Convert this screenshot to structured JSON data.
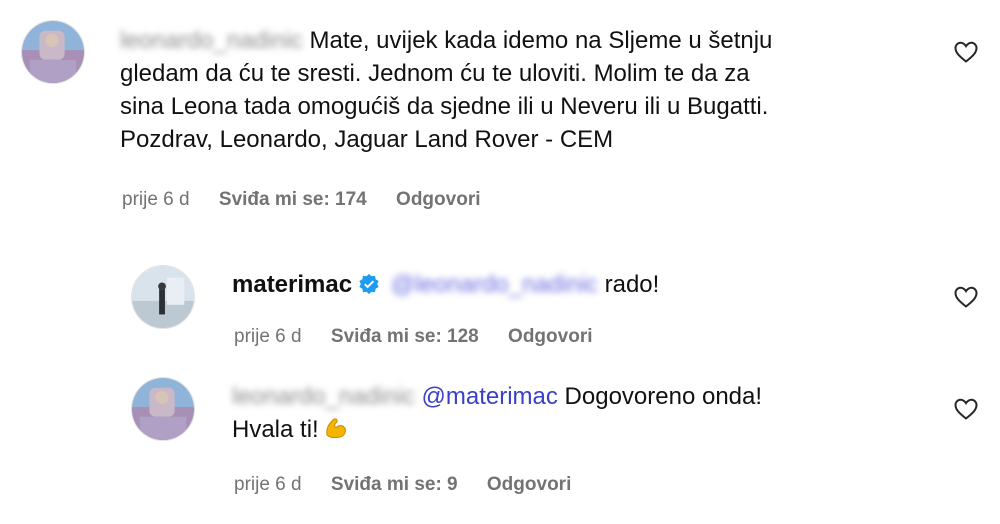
{
  "comments": [
    {
      "username": "leonardo_nadinic",
      "text": "Mate, uvijek kada idemo na Sljeme u šetnju gledam da ću te sresti. Jednom ću te uloviti. Molim te da za sina Leona tada omogućiš da sjedne ili u Neveru ili u Bugatti. Pozdrav, Leonardo, Jaguar Land Rover - CEM",
      "line1": "Mate, uvijek kada idemo na Sljeme u šetnju",
      "line2": "gledam da ću te sresti. Jednom ću te uloviti. Molim te da za",
      "line3": "sina Leona tada omogućiš da sjedne ili u Neveru ili u Bugatti.",
      "line4": "Pozdrav, Leonardo, Jaguar Land Rover - CEM",
      "time": "prije 6 d",
      "likes": "Sviđa mi se: 174",
      "reply": "Odgovori"
    },
    {
      "username": "materimac",
      "mention": "@leonardo_nadinic",
      "text": "rado!",
      "time": "prije 6 d",
      "likes": "Sviđa mi se: 128",
      "reply": "Odgovori"
    },
    {
      "username": "leonardo_nadinic",
      "mention": "@materimac",
      "text_line1": "Dogovoreno onda!",
      "text_line2": "Hvala ti!",
      "emoji": "flexed-biceps",
      "time": "prije 6 d",
      "likes": "Sviđa mi se: 9",
      "reply": "Odgovori"
    }
  ],
  "colors": {
    "meta": "#737373",
    "mention": "#3a40c8",
    "verified": "#1d9bf0",
    "emoji": "#f5b400"
  }
}
